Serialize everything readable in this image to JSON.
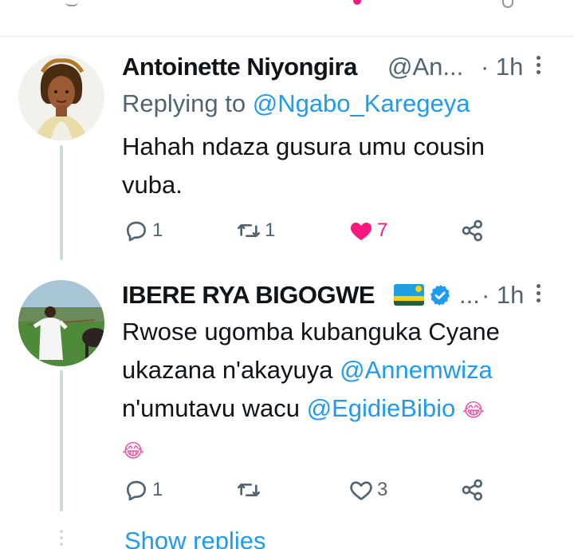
{
  "colors": {
    "accent": "#1d9bf0",
    "like": "#f91880",
    "secondary_text": "#536471",
    "primary_text": "#0f1419",
    "thread_line": "#cfd9de"
  },
  "tweets": [
    {
      "name": "Antoinette Niyongira",
      "handle": "@An...",
      "time": "· 1h",
      "replying_prefix": "Replying to",
      "replying_to": "@Ngabo_Karegeya",
      "text_line1": "Hahah ndaza gusura umu cousin",
      "text_line2": "vuba.",
      "actions": {
        "reply": "1",
        "retweet": "1",
        "like": "7",
        "liked": true
      },
      "icons": {
        "reply": "reply-icon",
        "retweet": "retweet-icon",
        "like": "heart-filled-icon",
        "share": "share-icon",
        "more": "more-icon"
      }
    },
    {
      "name": "IBERE RYA BIGOGWE",
      "handle": "...",
      "time": "· 1h",
      "text_line1": "Rwose ugomba kubanguka Cyane",
      "text_line2_prefix": "ukazana n'akayuya ",
      "mention_1": "@Annemwiza",
      "text_line3_prefix": "n'umutavu wacu ",
      "mention_2": "@EgidieBibio",
      "emoji_1": "😂",
      "emoji_2": "😂",
      "actions": {
        "reply": "1",
        "retweet": "",
        "like": "3",
        "liked": false
      },
      "icons": {
        "flag": "rwanda-flag-icon",
        "verified": "verified-badge-icon",
        "reply": "reply-icon",
        "retweet": "retweet-icon",
        "like": "heart-outline-icon",
        "share": "share-icon",
        "more": "more-icon"
      }
    }
  ],
  "show_replies": "Show replies"
}
